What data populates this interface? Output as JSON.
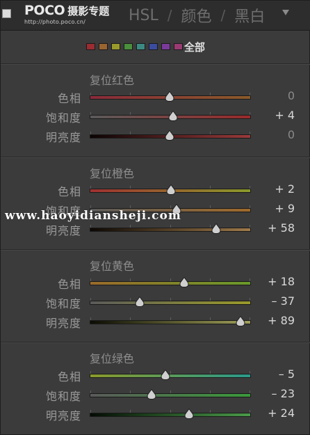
{
  "header": {
    "logo_main": "POCO",
    "logo_sub": "摄影专题",
    "logo_url": "http://photo.poco.cn/",
    "tabs": [
      "HSL",
      "颜色",
      "黑白"
    ],
    "separator": "/"
  },
  "swatches": {
    "colors": [
      "#9b2c32",
      "#9a6430",
      "#9a9a2c",
      "#4a8f3c",
      "#3b8a82",
      "#3b4ca0",
      "#7a3a9a",
      "#9a3a72"
    ],
    "all_label": "全部"
  },
  "watermark": "www.haoyidiansheji.com",
  "sections": [
    {
      "reset_label": "复位红色",
      "rows": [
        {
          "label": "色相",
          "value": "0",
          "level": 0,
          "track": [
            "#8a2a3a",
            "#8a5a2a"
          ]
        },
        {
          "label": "饱和度",
          "value": "+ 4",
          "level": 4,
          "track": [
            "#5a5a5a",
            "#9a2a2a"
          ]
        },
        {
          "label": "明亮度",
          "value": "0",
          "level": 0,
          "track": [
            "#0c0404",
            "#9a3a3a"
          ]
        }
      ]
    },
    {
      "reset_label": "复位橙色",
      "rows": [
        {
          "label": "色相",
          "value": "+ 2",
          "level": 2,
          "track": [
            "#a03030",
            "#8a9a2a"
          ]
        },
        {
          "label": "饱和度",
          "value": "+ 9",
          "level": 9,
          "track": [
            "#5a5a5a",
            "#a06a2a"
          ]
        },
        {
          "label": "明亮度",
          "value": "+ 58",
          "level": 58,
          "track": [
            "#0c0804",
            "#a07a4a"
          ]
        }
      ]
    },
    {
      "reset_label": "复位黄色",
      "rows": [
        {
          "label": "色相",
          "value": "+ 18",
          "level": 18,
          "track": [
            "#9a6a2a",
            "#6a9a2a"
          ]
        },
        {
          "label": "饱和度",
          "value": "– 37",
          "level": -37,
          "track": [
            "#5a5a5a",
            "#9a9a2a"
          ]
        },
        {
          "label": "明亮度",
          "value": "+ 89",
          "level": 89,
          "track": [
            "#0c0c04",
            "#a0a05a"
          ]
        }
      ]
    },
    {
      "reset_label": "复位绿色",
      "rows": [
        {
          "label": "色相",
          "value": "– 5",
          "level": -5,
          "track": [
            "#8a9a2a",
            "#2a9a8a"
          ]
        },
        {
          "label": "饱和度",
          "value": "– 23",
          "level": -23,
          "track": [
            "#5a5a5a",
            "#3a9a3a"
          ]
        },
        {
          "label": "明亮度",
          "value": "+ 24",
          "level": 24,
          "track": [
            "#040c04",
            "#4a9a4a"
          ]
        }
      ]
    }
  ]
}
